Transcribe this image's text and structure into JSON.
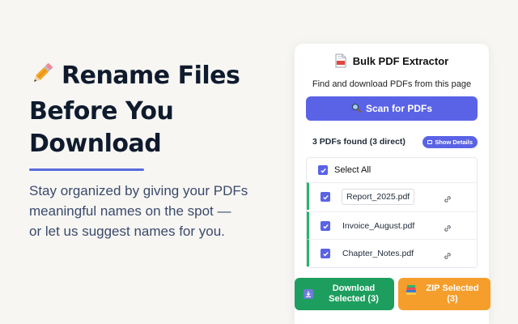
{
  "hero": {
    "icon": "pencil-icon",
    "title_line1": "Rename Files",
    "title_line2": "Before You",
    "title_line3": "Download",
    "subtitle_line1": "Stay organized by giving your PDFs",
    "subtitle_line2": "meaningful names on the spot —",
    "subtitle_line3": "or let us suggest names for you.",
    "accent_color": "#5b6be0"
  },
  "popup": {
    "icon": "pdf-file-icon",
    "title": "Bulk PDF Extractor",
    "description": "Find and download PDFs from this page",
    "scan_button": {
      "icon": "magnifier-icon",
      "label": "Scan for PDFs"
    },
    "found_text": "3 PDFs found (3 direct)",
    "details_button": "Show Details",
    "select_all": {
      "label": "Select All",
      "checked": true
    },
    "files": [
      {
        "name": "Report_2025.pdf",
        "checked": true,
        "editing": true,
        "icon": "link-icon"
      },
      {
        "name": "Invoice_August.pdf",
        "checked": true,
        "editing": false,
        "icon": "link-icon"
      },
      {
        "name": "Chapter_Notes.pdf",
        "checked": true,
        "editing": false,
        "icon": "link-icon"
      }
    ],
    "download_button": {
      "icon": "download-icon",
      "line1": "Download",
      "line2": "Selected (3)"
    },
    "zip_button": {
      "icon": "archive-books-icon",
      "line1": "ZIP Selected",
      "line2": "(3)"
    },
    "colors": {
      "primary": "#5a63e6",
      "success": "#1d9e5e",
      "row_accent": "#22b866",
      "warning": "#f59e2b"
    }
  }
}
